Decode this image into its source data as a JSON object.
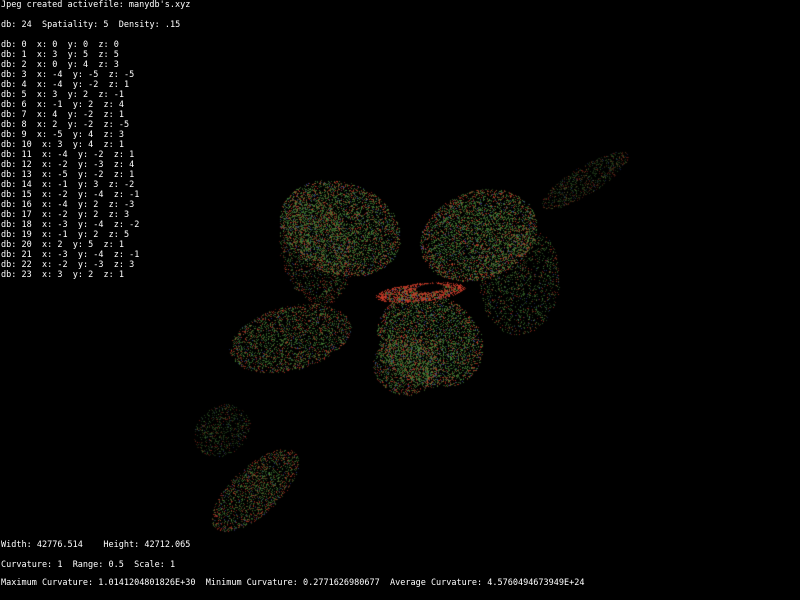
{
  "status": {
    "message": "Jpeg created activefile: manydb's.xyz"
  },
  "params": {
    "db_label": "db:",
    "db_value": "24",
    "spatiality_label": "Spatiality:",
    "spatiality_value": "5",
    "density_label": "Density:",
    "density_value": ".15"
  },
  "db_entries": [
    {
      "db": "0",
      "x": "0",
      "y": "0",
      "z": "0"
    },
    {
      "db": "1",
      "x": "3",
      "y": "5",
      "z": "5"
    },
    {
      "db": "2",
      "x": "0",
      "y": "4",
      "z": "3"
    },
    {
      "db": "3",
      "x": "-4",
      "y": "-5",
      "z": "-5"
    },
    {
      "db": "4",
      "x": "-4",
      "y": "-2",
      "z": "1"
    },
    {
      "db": "5",
      "x": "3",
      "y": "2",
      "z": "-1"
    },
    {
      "db": "6",
      "x": "-1",
      "y": "2",
      "z": "4"
    },
    {
      "db": "7",
      "x": "4",
      "y": "-2",
      "z": "1"
    },
    {
      "db": "8",
      "x": "2",
      "y": "-2",
      "z": "-5"
    },
    {
      "db": "9",
      "x": "-5",
      "y": "4",
      "z": "3"
    },
    {
      "db": "10",
      "x": "3",
      "y": "4",
      "z": "1"
    },
    {
      "db": "11",
      "x": "-4",
      "y": "-2",
      "z": "1"
    },
    {
      "db": "12",
      "x": "-2",
      "y": "-3",
      "z": "4"
    },
    {
      "db": "13",
      "x": "-5",
      "y": "-2",
      "z": "1"
    },
    {
      "db": "14",
      "x": "-1",
      "y": "3",
      "z": "-2"
    },
    {
      "db": "15",
      "x": "-2",
      "y": "-4",
      "z": "-1"
    },
    {
      "db": "16",
      "x": "-4",
      "y": "2",
      "z": "-3"
    },
    {
      "db": "17",
      "x": "-2",
      "y": "2",
      "z": "3"
    },
    {
      "db": "18",
      "x": "-3",
      "y": "-4",
      "z": "-2"
    },
    {
      "db": "19",
      "x": "-1",
      "y": "2",
      "z": "5"
    },
    {
      "db": "20",
      "x": "2",
      "y": "5",
      "z": "1"
    },
    {
      "db": "21",
      "x": "-3",
      "y": "-4",
      "z": "-1"
    },
    {
      "db": "22",
      "x": "-2",
      "y": "-3",
      "z": "3"
    },
    {
      "db": "23",
      "x": "3",
      "y": "2",
      "z": "1"
    }
  ],
  "dimensions": {
    "width_label": "Width:",
    "width_value": "42776.514",
    "height_label": "Height:",
    "height_value": "42712.065"
  },
  "settings": {
    "curvature_label": "Curvature:",
    "curvature_value": "1",
    "range_label": "Range:",
    "range_value": "0.5",
    "scale_label": "Scale:",
    "scale_value": "1"
  },
  "stats": {
    "max_curvature_label": "Maximum Curvature:",
    "max_curvature_value": "1.0141204801826E+30",
    "min_curvature_label": "Minimum Curvature:",
    "min_curvature_value": "0.2771626980677",
    "avg_curvature_label": "Average Curvature:",
    "avg_curvature_value": "4.5760494673949E+24"
  },
  "colors": {
    "background": "#000000",
    "text": "#ffffff",
    "point_green": "#4a8a3a",
    "point_red": "#c83a28",
    "point_blue": "#3a4aa0"
  }
}
